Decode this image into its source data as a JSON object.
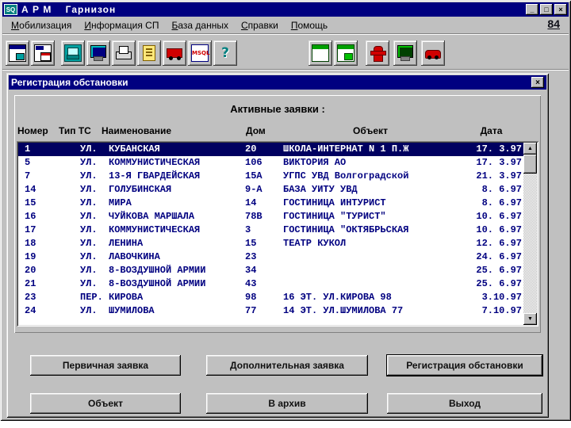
{
  "window": {
    "title": "А Р М    Гарнизон",
    "icon_text": "SQ",
    "controls": {
      "minimize": "_",
      "restore": "□",
      "close": "×"
    }
  },
  "badge": "84",
  "menu": {
    "items": [
      {
        "id": "mobilization",
        "label": "Мобилизация"
      },
      {
        "id": "sp-info",
        "label": "Информация СП"
      },
      {
        "id": "database",
        "label": "База данных"
      },
      {
        "id": "references",
        "label": "Справки"
      },
      {
        "id": "help",
        "label": "Помощь"
      }
    ]
  },
  "toolbar": {
    "groups": [
      {
        "icons": [
          {
            "name": "cascade-window-icon",
            "type": "win1"
          },
          {
            "name": "switch-window-icon",
            "type": "win2"
          }
        ]
      },
      {
        "icons": [
          {
            "name": "computer-icon",
            "type": "computer"
          },
          {
            "name": "monitor-icon",
            "type": "monitor"
          },
          {
            "name": "printer-icon",
            "type": "printer"
          },
          {
            "name": "document-icon",
            "type": "doc"
          },
          {
            "name": "fire-truck-icon",
            "type": "truck"
          },
          {
            "name": "msql-icon",
            "type": "msql",
            "glyph": "MSQL"
          },
          {
            "name": "help-icon",
            "type": "help",
            "glyph": "?"
          }
        ]
      },
      {
        "icons": [
          {
            "name": "green-window-icon-1",
            "type": "gwin1"
          },
          {
            "name": "green-window-icon-2",
            "type": "gwin2"
          }
        ]
      },
      {
        "icons": [
          {
            "name": "hydrant-icon",
            "type": "hydrant"
          },
          {
            "name": "green-monitor-icon",
            "type": "greenmon"
          },
          {
            "name": "fire-car-icon",
            "type": "car"
          }
        ]
      }
    ]
  },
  "dialog": {
    "title": "Регистрация обстановки",
    "close_glyph": "×",
    "section_title": "Активные заявки :",
    "columns": [
      "Номер",
      "Тип ТС",
      "Наименование",
      "Дом",
      "Объект",
      "Дата"
    ],
    "rows": [
      {
        "num": "1",
        "type": "УЛ.",
        "name": "КУБАНСКАЯ",
        "house": "20",
        "object": "ШКОЛА-ИНТЕРНАТ N 1 П.Ж",
        "date": "17. 3.97",
        "selected": true
      },
      {
        "num": "5",
        "type": "УЛ.",
        "name": "КОММУНИСТИЧЕСКАЯ",
        "house": "106",
        "object": "ВИКТОРИЯ АО",
        "date": "17. 3.97"
      },
      {
        "num": "7",
        "type": "УЛ.",
        "name": "13-Я ГВАРДЕЙСКАЯ",
        "house": "15А",
        "object": "УГПС УВД Волгоградской",
        "date": "21. 3.97"
      },
      {
        "num": "14",
        "type": "УЛ.",
        "name": "ГОЛУБИНСКАЯ",
        "house": "9-А",
        "object": "БАЗА УИТУ УВД",
        "date": "8. 6.97"
      },
      {
        "num": "15",
        "type": "УЛ.",
        "name": "МИРА",
        "house": "14",
        "object": "ГОСТИНИЦА ИНТУРИСТ",
        "date": "8. 6.97"
      },
      {
        "num": "16",
        "type": "УЛ.",
        "name": "ЧУЙКОВА МАРШАЛА",
        "house": "78В",
        "object": "ГОСТИНИЦА \"ТУРИСТ\"",
        "date": "10. 6.97"
      },
      {
        "num": "17",
        "type": "УЛ.",
        "name": "КОММУНИСТИЧЕСКАЯ",
        "house": "3",
        "object": "ГОСТИНИЦА \"ОКТЯБРЬСКАЯ",
        "date": "10. 6.97"
      },
      {
        "num": "18",
        "type": "УЛ.",
        "name": "ЛЕНИНА",
        "house": "15",
        "object": "ТЕАТР КУКОЛ",
        "date": "12. 6.97"
      },
      {
        "num": "19",
        "type": "УЛ.",
        "name": "ЛАВОЧКИНА",
        "house": "23",
        "object": "",
        "date": "24. 6.97"
      },
      {
        "num": "20",
        "type": "УЛ.",
        "name": "8-ВОЗДУШНОЙ АРМИИ",
        "house": "34",
        "object": "",
        "date": "25. 6.97"
      },
      {
        "num": "21",
        "type": "УЛ.",
        "name": "8-ВОЗДУШНОЙ АРМИИ",
        "house": "43",
        "object": "",
        "date": "25. 6.97"
      },
      {
        "num": "23",
        "type": "ПЕР.",
        "name": "КИРОВА",
        "house": "98",
        "object": "16 ЭТ. УЛ.КИРОВА 98",
        "date": "3.10.97"
      },
      {
        "num": "24",
        "type": "УЛ.",
        "name": "ШУМИЛОВА",
        "house": "77",
        "object": "14 ЭТ. УЛ.ШУМИЛОВА 77",
        "date": "7.10.97"
      }
    ],
    "scrollbar": {
      "up": "▲",
      "down": "▼"
    },
    "buttons": {
      "primary": "Первичная заявка",
      "additional": "Дополнительная заявка",
      "register": "Регистрация обстановки",
      "object": "Объект",
      "archive": "В архив",
      "exit": "Выход"
    }
  },
  "colors": {
    "titlebar": "#000080",
    "selection": "#000060",
    "table_text": "#000080",
    "button_face": "#c0c0c0"
  }
}
